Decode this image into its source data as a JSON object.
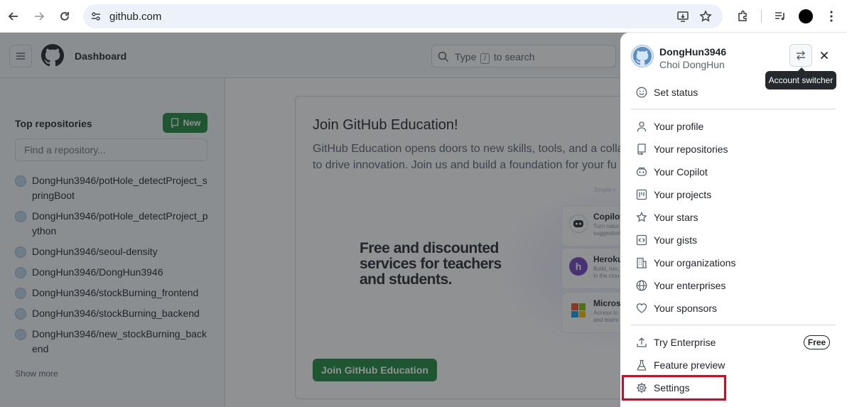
{
  "browser": {
    "url": "github.com"
  },
  "header": {
    "title": "Dashboard",
    "search_prefix": "Type",
    "search_key": "/",
    "search_suffix": "to search"
  },
  "sidebar": {
    "heading": "Top repositories",
    "new_label": "New",
    "find_placeholder": "Find a repository...",
    "repos": [
      "DongHun3946/potHole_detectProject_springBoot",
      "DongHun3946/potHole_detectProject_python",
      "DongHun3946/seoul-density",
      "DongHun3946/DongHun3946",
      "DongHun3946/stockBurning_frontend",
      "DongHun3946/stockBurning_backend",
      "DongHun3946/new_stockBurning_backend"
    ],
    "show_more": "Show more"
  },
  "education": {
    "title": "Join GitHub Education!",
    "desc_line1": "GitHub Education opens doors to new skills, tools, and a colla",
    "desc_line2": "to drive innovation. Join us and build a foundation for your fu",
    "promo_line1": "Free and discounted",
    "promo_line2": "services for teachers",
    "promo_line3": "and students.",
    "services": [
      {
        "name": "Copilot",
        "desc1": "Turn natur",
        "desc2": "suggestion"
      },
      {
        "name": "Heroku",
        "desc1": "Build, run,",
        "desc2": "in the clou"
      },
      {
        "name": "Microso",
        "desc1": "Access to",
        "desc2": "and learni"
      }
    ],
    "top_hint": "Simple c",
    "join_label": "Join GitHub Education"
  },
  "account": {
    "username": "DongHun3946",
    "fullname": "Choi DongHun",
    "tooltip": "Account switcher",
    "set_status": "Set status",
    "items": [
      {
        "label": "Your profile",
        "icon": "person-icon"
      },
      {
        "label": "Your repositories",
        "icon": "repo-icon"
      },
      {
        "label": "Your Copilot",
        "icon": "copilot-icon"
      },
      {
        "label": "Your projects",
        "icon": "project-icon"
      },
      {
        "label": "Your stars",
        "icon": "star-icon"
      },
      {
        "label": "Your gists",
        "icon": "code-square-icon"
      },
      {
        "label": "Your organizations",
        "icon": "organization-icon"
      },
      {
        "label": "Your enterprises",
        "icon": "globe-icon"
      },
      {
        "label": "Your sponsors",
        "icon": "heart-icon"
      }
    ],
    "try_enterprise": "Try Enterprise",
    "free_badge": "Free",
    "feature_preview": "Feature preview",
    "settings": "Settings"
  },
  "colors": {
    "accent_green": "#1f883d",
    "highlight_red": "#e5001e"
  }
}
